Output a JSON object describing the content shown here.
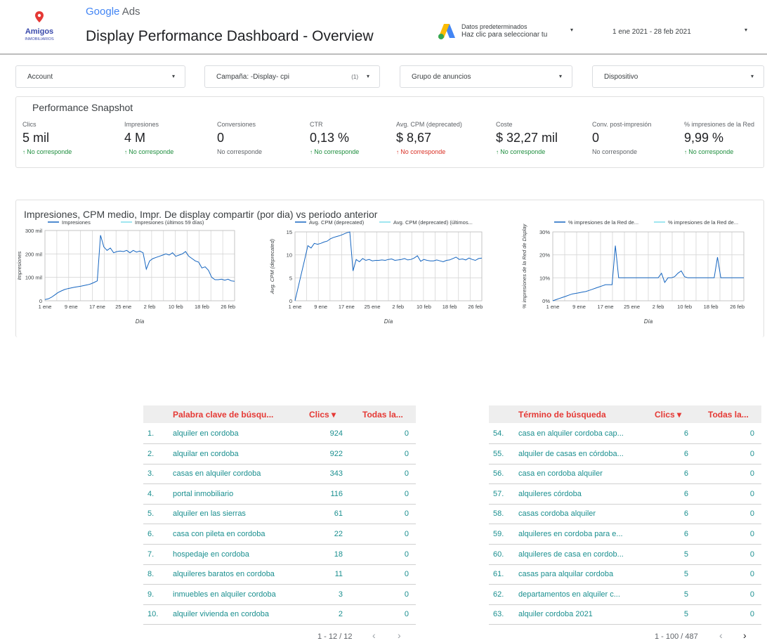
{
  "header": {
    "brand_google": "Google",
    "brand_ads": " Ads",
    "title": "Display Performance Dashboard - Overview",
    "data_source_line1": "Datos predeterminados",
    "data_source_line2": "Haz clic para seleccionar tu",
    "date_range": "1 ene 2021 - 28 feb 2021",
    "dropdown_glyph": "▾"
  },
  "logo": {
    "line1": "Amigos",
    "line2": "INMOBILIARIOS"
  },
  "filters": [
    {
      "label": "Account",
      "count": ""
    },
    {
      "label": "Campaña: -Display- cpi",
      "count": "(1)"
    },
    {
      "label": "Grupo de anuncios",
      "count": ""
    },
    {
      "label": "Dispositivo",
      "count": ""
    }
  ],
  "snapshot": {
    "title": "Performance Snapshot",
    "kpis": [
      {
        "name": "Clics",
        "value": "5 mil",
        "compare": "No corresponde",
        "trend": "up",
        "color": "#1e8e3e"
      },
      {
        "name": "Impresiones",
        "value": "4 M",
        "compare": "No corresponde",
        "trend": "up",
        "color": "#1e8e3e"
      },
      {
        "name": "Conversiones",
        "value": "0",
        "compare": "No corresponde",
        "trend": "none",
        "color": "#5f6368"
      },
      {
        "name": "CTR",
        "value": "0,13 %",
        "compare": "No corresponde",
        "trend": "up",
        "color": "#1e8e3e"
      },
      {
        "name": "Avg. CPM (deprecated)",
        "value": "$ 8,67",
        "compare": "No corresponde",
        "trend": "up",
        "color": "#d93025"
      },
      {
        "name": "Coste",
        "value": "$ 32,27 mil",
        "compare": "No corresponde",
        "trend": "up",
        "color": "#1e8e3e"
      },
      {
        "name": "Conv. post-impresión",
        "value": "0",
        "compare": "No corresponde",
        "trend": "none",
        "color": "#5f6368"
      },
      {
        "name": "% impresiones de la Red",
        "value": "9,99 %",
        "compare": "No corresponde",
        "trend": "up",
        "color": "#1e8e3e"
      }
    ]
  },
  "charts_title": "Impresiones, CPM medio, Impr. De display compartir (por dia) vs periodo anterior",
  "chart_data": [
    {
      "type": "line",
      "title": "",
      "xlabel": "Día",
      "ylabel": "Impresiones",
      "x_ticks": [
        "1 ene",
        "9 ene",
        "17 ene",
        "25 ene",
        "2 feb",
        "10 feb",
        "18 feb",
        "26 feb"
      ],
      "y_ticks": [
        "0",
        "100 mil",
        "200 mil",
        "300 mil"
      ],
      "ylim": [
        0,
        300000
      ],
      "legend": "top",
      "series": [
        {
          "name": "Impresiones",
          "color": "#1565c0",
          "values": [
            5000,
            8000,
            15000,
            25000,
            35000,
            42000,
            48000,
            52000,
            55000,
            58000,
            60000,
            62000,
            65000,
            68000,
            72000,
            78000,
            85000,
            280000,
            230000,
            215000,
            225000,
            205000,
            210000,
            212000,
            210000,
            215000,
            205000,
            215000,
            208000,
            212000,
            205000,
            135000,
            170000,
            180000,
            185000,
            190000,
            195000,
            200000,
            195000,
            205000,
            190000,
            195000,
            200000,
            210000,
            190000,
            180000,
            170000,
            165000,
            140000,
            145000,
            130000,
            100000,
            90000,
            90000,
            92000,
            88000,
            92000,
            85000,
            83000
          ]
        },
        {
          "name": "Impresiones (últimos 59 días)",
          "color": "#80deea",
          "values": []
        }
      ]
    },
    {
      "type": "line",
      "title": "",
      "xlabel": "Día",
      "ylabel": "Avg. CPM (deprecated)",
      "x_ticks": [
        "1 ene",
        "9 ene",
        "17 ene",
        "25 ene",
        "2 feb",
        "10 feb",
        "18 feb",
        "26 feb"
      ],
      "y_ticks": [
        "0",
        "5",
        "10",
        "15"
      ],
      "ylim": [
        0,
        15
      ],
      "legend": "top",
      "series": [
        {
          "name": "Avg. CPM (deprecated)",
          "color": "#1565c0",
          "values": [
            0,
            3,
            6,
            9,
            12,
            11.5,
            12.5,
            12.3,
            12.5,
            12.8,
            13,
            13.5,
            13.8,
            14,
            14.2,
            14.5,
            14.8,
            15,
            6.5,
            9,
            8.5,
            9.2,
            8.8,
            9,
            8.7,
            8.8,
            8.8,
            8.9,
            8.8,
            9,
            9.1,
            8.8,
            8.9,
            9,
            9.2,
            8.9,
            9,
            9.3,
            9.8,
            8.6,
            9,
            8.8,
            8.7,
            8.7,
            8.9,
            8.7,
            8.5,
            8.8,
            8.9,
            9.2,
            9.5,
            9,
            9.1,
            8.9,
            9.3,
            9,
            8.8,
            9.2,
            9.3
          ]
        },
        {
          "name": "Avg. CPM (deprecated) (últimos...",
          "color": "#80deea",
          "values": []
        }
      ]
    },
    {
      "type": "line",
      "title": "",
      "xlabel": "Día",
      "ylabel": "% impresiones de la Red de Display",
      "x_ticks": [
        "1 ene",
        "9 ene",
        "17 ene",
        "25 ene",
        "2 feb",
        "10 feb",
        "18 feb",
        "26 feb"
      ],
      "y_ticks": [
        "0%",
        "10%",
        "20%",
        "30%"
      ],
      "ylim": [
        0,
        30
      ],
      "legend": "top",
      "series": [
        {
          "name": "% impresiones de la Red de...",
          "color": "#1565c0",
          "values": [
            0,
            0.5,
            1,
            1.5,
            2,
            2.5,
            3,
            3.2,
            3.5,
            3.8,
            4,
            4.5,
            5,
            5.5,
            6,
            6.5,
            7,
            7,
            7,
            24,
            10,
            10,
            10,
            10,
            10,
            10,
            10,
            10,
            10,
            10,
            10,
            10,
            10,
            12,
            8,
            10,
            10,
            10.5,
            12,
            13,
            10.5,
            10,
            10,
            10,
            10,
            10,
            10,
            10,
            10,
            10,
            19,
            10,
            10,
            10,
            10,
            10,
            10,
            10,
            10
          ]
        },
        {
          "name": "% impresiones de la Red de...",
          "color": "#80deea",
          "values": []
        }
      ]
    }
  ],
  "table_keywords": {
    "headers": [
      "Palabra clave de búsqu...",
      "Clics ▾",
      "Todas la..."
    ],
    "rows": [
      {
        "idx": "1.",
        "term": "alquiler en cordoba",
        "clics": "924",
        "todas": "0"
      },
      {
        "idx": "2.",
        "term": "alquilar en cordoba",
        "clics": "922",
        "todas": "0"
      },
      {
        "idx": "3.",
        "term": "casas en alquiler cordoba",
        "clics": "343",
        "todas": "0"
      },
      {
        "idx": "4.",
        "term": "portal inmobiliario",
        "clics": "116",
        "todas": "0"
      },
      {
        "idx": "5.",
        "term": "alquiler en las sierras",
        "clics": "61",
        "todas": "0"
      },
      {
        "idx": "6.",
        "term": "casa con pileta en cordoba",
        "clics": "22",
        "todas": "0"
      },
      {
        "idx": "7.",
        "term": "hospedaje en cordoba",
        "clics": "18",
        "todas": "0"
      },
      {
        "idx": "8.",
        "term": "alquileres baratos en cordoba",
        "clics": "11",
        "todas": "0"
      },
      {
        "idx": "9.",
        "term": "inmuebles en alquiler cordoba",
        "clics": "3",
        "todas": "0"
      },
      {
        "idx": "10.",
        "term": "alquiler vivienda en cordoba",
        "clics": "2",
        "todas": "0"
      }
    ],
    "pager": "1 - 12 / 12"
  },
  "table_terms": {
    "headers": [
      "Término de búsqueda",
      "Clics ▾",
      "Todas la..."
    ],
    "rows": [
      {
        "idx": "54.",
        "term": "casa en alquiler cordoba cap...",
        "clics": "6",
        "todas": "0"
      },
      {
        "idx": "55.",
        "term": "alquiler de casas en córdoba...",
        "clics": "6",
        "todas": "0"
      },
      {
        "idx": "56.",
        "term": "casa en cordoba alquiler",
        "clics": "6",
        "todas": "0"
      },
      {
        "idx": "57.",
        "term": "alquileres córdoba",
        "clics": "6",
        "todas": "0"
      },
      {
        "idx": "58.",
        "term": "casas cordoba alquiler",
        "clics": "6",
        "todas": "0"
      },
      {
        "idx": "59.",
        "term": "alquileres en cordoba para e...",
        "clics": "6",
        "todas": "0"
      },
      {
        "idx": "60.",
        "term": "alquileres de casa en cordob...",
        "clics": "5",
        "todas": "0"
      },
      {
        "idx": "61.",
        "term": "casas para alquilar cordoba",
        "clics": "5",
        "todas": "0"
      },
      {
        "idx": "62.",
        "term": "departamentos en alquiler c...",
        "clics": "5",
        "todas": "0"
      },
      {
        "idx": "63.",
        "term": "alquiler cordoba 2021",
        "clics": "5",
        "todas": "0"
      }
    ],
    "pager": "1 - 100 / 487"
  },
  "pager_prev": "‹",
  "pager_next": "›",
  "colors": {
    "accent_red": "#e53935",
    "link_teal": "#1a8f8f",
    "positive": "#1e8e3e",
    "negative": "#d93025"
  }
}
